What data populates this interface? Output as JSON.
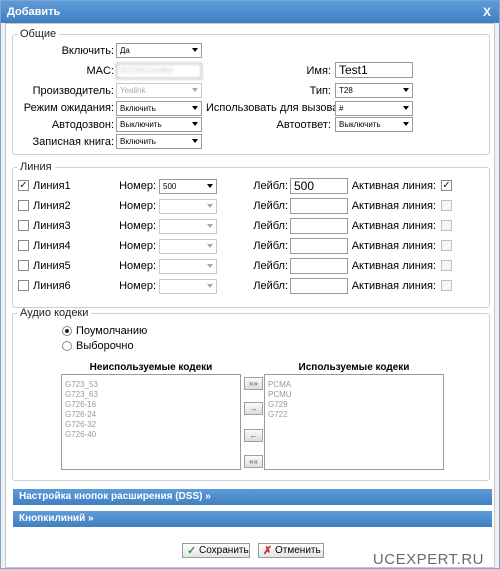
{
  "dialog": {
    "title": "Добавить",
    "close_label": "X"
  },
  "general": {
    "legend": "Общие",
    "enable_label": "Включить:",
    "enable_value": "Да",
    "mac_label": "MAC:",
    "mac_value": "0015651a04b9",
    "name_label": "Имя:",
    "name_value": "Test1",
    "vendor_label": "Производитель:",
    "vendor_value": "Yealink",
    "type_label": "Тип:",
    "type_value": "T28",
    "standby_label": "Режим ожидания:",
    "standby_value": "Включить",
    "usecall_label": "Использовать для вызова:",
    "usecall_value": "#",
    "autodial_label": "Автодозвон:",
    "autodial_value": "Выключить",
    "autoanswer_label": "Автоответ:",
    "autoanswer_value": "Выключить",
    "phonebook_label": "Записная книга:",
    "phonebook_value": "Включить"
  },
  "lines": {
    "legend": "Линия",
    "number_label": "Номер:",
    "label_label": "Лейбл:",
    "active_label": "Активная линия:",
    "rows": [
      {
        "name": "Линия1",
        "checked": "✓",
        "number": "500",
        "label": "500",
        "active": "✓"
      },
      {
        "name": "Линия2",
        "checked": "",
        "number": "",
        "label": "",
        "active": ""
      },
      {
        "name": "Линия3",
        "checked": "",
        "number": "",
        "label": "",
        "active": ""
      },
      {
        "name": "Линия4",
        "checked": "",
        "number": "",
        "label": "",
        "active": ""
      },
      {
        "name": "Линия5",
        "checked": "",
        "number": "",
        "label": "",
        "active": ""
      },
      {
        "name": "Линия6",
        "checked": "",
        "number": "",
        "label": "",
        "active": ""
      }
    ]
  },
  "audio": {
    "legend": "Аудио кодеки",
    "default_label": "Поумолчанию",
    "custom_label": "Выборочно",
    "unused_title": "Неиспользуемые кодеки",
    "used_title": "Используемые кодеки",
    "unused": [
      "G723_53",
      "G723_63",
      "G726-16",
      "G726-24",
      "G726-32",
      "G726-40"
    ],
    "used": [
      "PCMA",
      "PCMU",
      "G729",
      "G722"
    ],
    "btn_all_right": "»»",
    "btn_right": "→",
    "btn_left": "←",
    "btn_all_left": "««"
  },
  "sections": {
    "dss": "Настройка кнопок расширения (DSS) »",
    "linekeys": "Кнопкилиний »"
  },
  "footer": {
    "save": "Сохранить",
    "cancel": "Отменить"
  },
  "watermark": "UCEXPERT.RU"
}
